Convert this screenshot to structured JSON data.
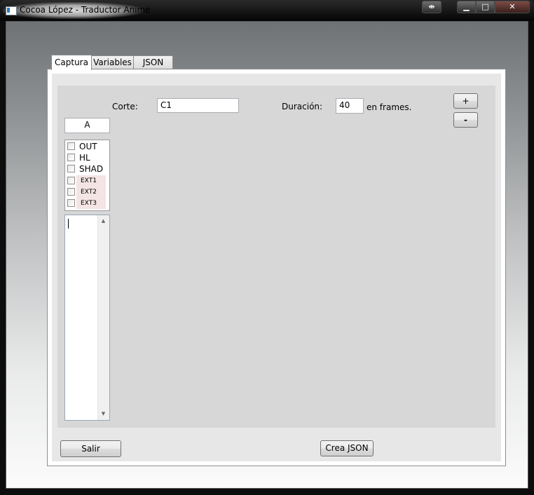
{
  "window": {
    "title": "Cocoa López - Traductor Anime",
    "controls": {
      "pin": "⇼",
      "minimize": "▁",
      "maximize": "□",
      "close": "✕"
    }
  },
  "tabs": [
    {
      "label": "Captura",
      "active": true
    },
    {
      "label": "Variables",
      "active": false
    },
    {
      "label": "JSON",
      "active": false
    }
  ],
  "captura": {
    "corte_label": "Corte:",
    "corte_value": "C1",
    "duracion_label": "Duración:",
    "duracion_value": "40",
    "frames_label": "en frames.",
    "plus_button": "+",
    "minus_button": "-",
    "layer_value": "A",
    "checkboxes": [
      {
        "label": "OUT",
        "checked": false
      },
      {
        "label": "HL",
        "checked": false
      },
      {
        "label": "SHAD",
        "checked": false
      },
      {
        "label": "EXT1",
        "checked": false
      },
      {
        "label": "EXT2",
        "checked": false
      },
      {
        "label": "EXT3",
        "checked": false
      }
    ],
    "notes_value": ""
  },
  "footer": {
    "salir_button": "Salir",
    "crea_json_button": "Crea JSON"
  },
  "icons": {
    "scroll_up": "▲",
    "scroll_down": "▼"
  }
}
